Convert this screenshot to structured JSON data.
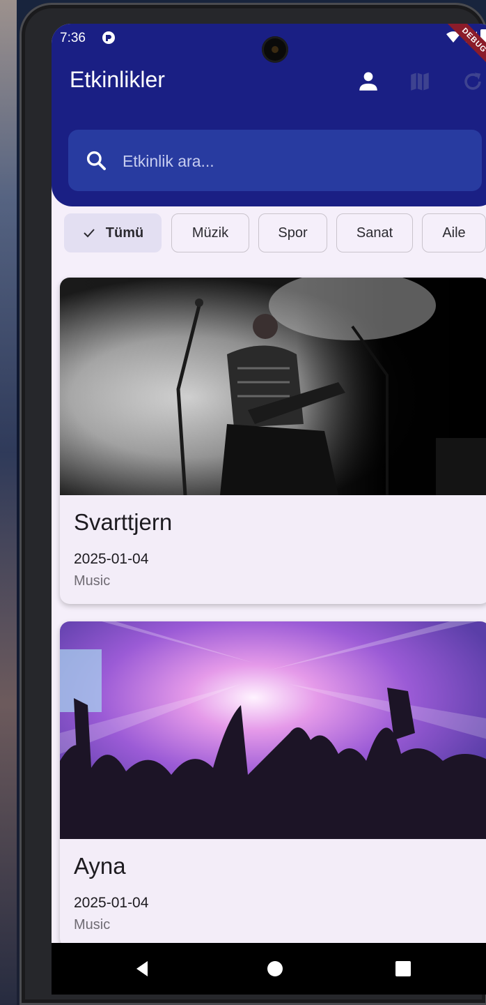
{
  "status_bar": {
    "time": "7:36",
    "debug_label": "DEBUG"
  },
  "app_bar": {
    "title": "Etkinlikler",
    "actions": [
      {
        "icon": "person-icon"
      },
      {
        "icon": "map-icon"
      },
      {
        "icon": "refresh-icon"
      }
    ]
  },
  "search": {
    "placeholder": "Etkinlik ara...",
    "value": ""
  },
  "filters": [
    {
      "label": "Tümü",
      "selected": true
    },
    {
      "label": "Müzik",
      "selected": false
    },
    {
      "label": "Spor",
      "selected": false
    },
    {
      "label": "Sanat",
      "selected": false
    },
    {
      "label": "Aile",
      "selected": false
    }
  ],
  "events": [
    {
      "title": "Svarttjern",
      "date": "2025-01-04",
      "category": "Music",
      "image": "concert-guitarist-photo"
    },
    {
      "title": "Ayna",
      "date": "2025-01-04",
      "category": "Music",
      "image": "concert-crowd-photo"
    }
  ],
  "colors": {
    "app_bar": "#1a1f84",
    "search_field": "#283ba0",
    "background": "#f5effa",
    "chip_selected": "#e3dff2"
  },
  "nav": [
    {
      "icon": "back-icon"
    },
    {
      "icon": "home-icon"
    },
    {
      "icon": "recents-icon"
    }
  ]
}
